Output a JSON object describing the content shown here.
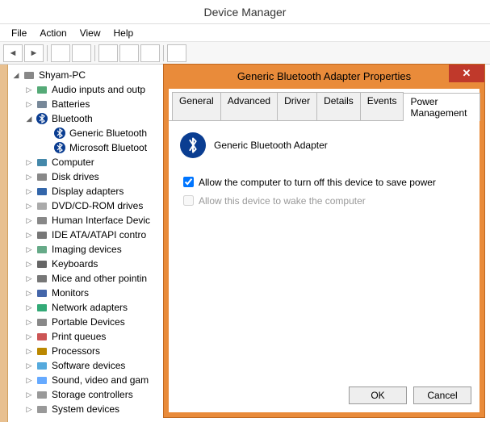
{
  "window": {
    "title": "Device Manager",
    "menu": [
      "File",
      "Action",
      "View",
      "Help"
    ]
  },
  "tree": {
    "root": "Shyam-PC",
    "items": [
      {
        "label": "Audio inputs and outp",
        "expanded": false,
        "indent": 1,
        "icon": "audio"
      },
      {
        "label": "Batteries",
        "expanded": false,
        "indent": 1,
        "icon": "battery"
      },
      {
        "label": "Bluetooth",
        "expanded": true,
        "indent": 1,
        "icon": "bt"
      },
      {
        "label": "Generic Bluetooth",
        "expanded": null,
        "indent": 2,
        "icon": "bt"
      },
      {
        "label": "Microsoft Bluetoot",
        "expanded": null,
        "indent": 2,
        "icon": "bt"
      },
      {
        "label": "Computer",
        "expanded": false,
        "indent": 1,
        "icon": "computer"
      },
      {
        "label": "Disk drives",
        "expanded": false,
        "indent": 1,
        "icon": "disk"
      },
      {
        "label": "Display adapters",
        "expanded": false,
        "indent": 1,
        "icon": "display"
      },
      {
        "label": "DVD/CD-ROM drives",
        "expanded": false,
        "indent": 1,
        "icon": "dvd"
      },
      {
        "label": "Human Interface Devic",
        "expanded": false,
        "indent": 1,
        "icon": "hid"
      },
      {
        "label": "IDE ATA/ATAPI contro",
        "expanded": false,
        "indent": 1,
        "icon": "ide"
      },
      {
        "label": "Imaging devices",
        "expanded": false,
        "indent": 1,
        "icon": "imaging"
      },
      {
        "label": "Keyboards",
        "expanded": false,
        "indent": 1,
        "icon": "keyboard"
      },
      {
        "label": "Mice and other pointin",
        "expanded": false,
        "indent": 1,
        "icon": "mouse"
      },
      {
        "label": "Monitors",
        "expanded": false,
        "indent": 1,
        "icon": "monitor"
      },
      {
        "label": "Network adapters",
        "expanded": false,
        "indent": 1,
        "icon": "network"
      },
      {
        "label": "Portable Devices",
        "expanded": false,
        "indent": 1,
        "icon": "portable"
      },
      {
        "label": "Print queues",
        "expanded": false,
        "indent": 1,
        "icon": "printer"
      },
      {
        "label": "Processors",
        "expanded": false,
        "indent": 1,
        "icon": "cpu"
      },
      {
        "label": "Software devices",
        "expanded": false,
        "indent": 1,
        "icon": "software"
      },
      {
        "label": "Sound, video and gam",
        "expanded": false,
        "indent": 1,
        "icon": "sound"
      },
      {
        "label": "Storage controllers",
        "expanded": false,
        "indent": 1,
        "icon": "storage"
      },
      {
        "label": "System devices",
        "expanded": false,
        "indent": 1,
        "icon": "system"
      }
    ]
  },
  "dialog": {
    "title": "Generic Bluetooth Adapter Properties",
    "tabs": [
      "General",
      "Advanced",
      "Driver",
      "Details",
      "Events",
      "Power Management"
    ],
    "active_tab": 5,
    "device_name": "Generic Bluetooth Adapter",
    "opt1_label": "Allow the computer to turn off this device to save power",
    "opt1_checked": true,
    "opt2_label": "Allow this device to wake the computer",
    "opt2_checked": false,
    "opt2_disabled": true,
    "ok_label": "OK",
    "cancel_label": "Cancel"
  }
}
